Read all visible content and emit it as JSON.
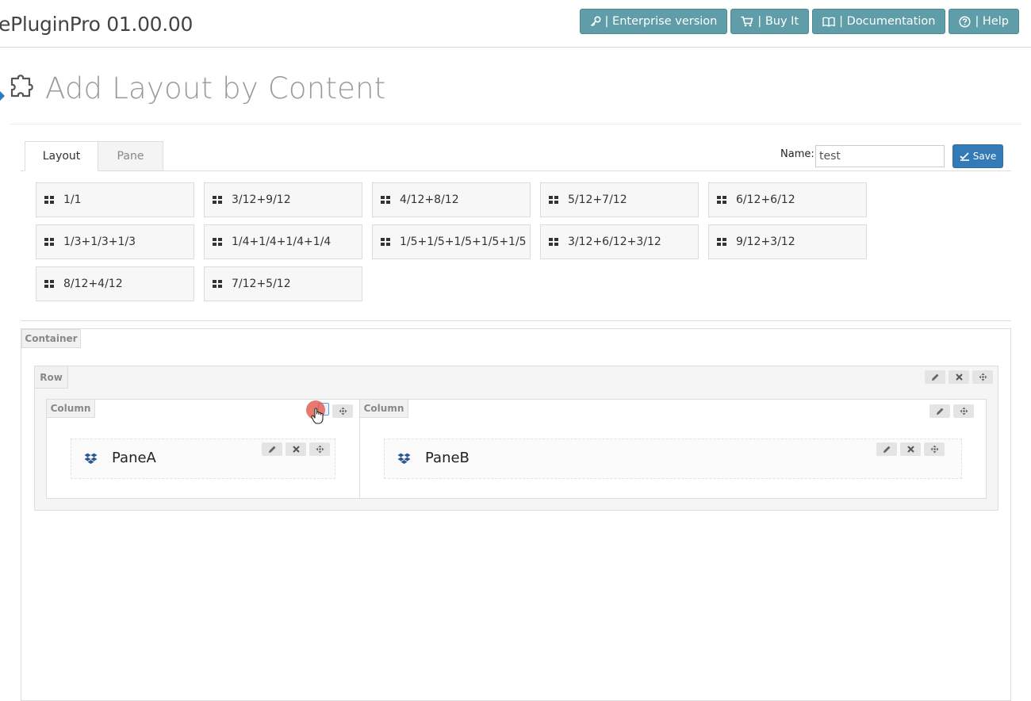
{
  "app": {
    "title": "ePluginPro 01.00.00"
  },
  "header": {
    "buttons": [
      {
        "label": "| Enterprise version",
        "icon": "key-icon"
      },
      {
        "label": "| Buy It",
        "icon": "cart-icon"
      },
      {
        "label": "| Documentation",
        "icon": "book-icon"
      },
      {
        "label": "| Help",
        "icon": "help-circle-icon"
      }
    ],
    "button_color": "#5f9ea8"
  },
  "page": {
    "title": "Add Layout by Content",
    "icon": "puzzle-icon"
  },
  "tabs": [
    {
      "label": "Layout",
      "active": true
    },
    {
      "label": "Pane",
      "active": false
    }
  ],
  "form": {
    "name_label": "Name:",
    "name_value": "test",
    "save_label": "Save",
    "save_color": "#337ab7"
  },
  "layouts": [
    "1/1",
    "3/12+9/12",
    "4/12+8/12",
    "5/12+7/12",
    "6/12+6/12",
    "1/3+1/3+1/3",
    "1/4+1/4+1/4+1/4",
    "1/5+1/5+1/5+1/5+1/5",
    "3/12+6/12+3/12",
    "9/12+3/12",
    "8/12+4/12",
    "7/12+5/12"
  ],
  "builder": {
    "container_label": "Container",
    "row_label": "Row",
    "columns": [
      {
        "label": "Column",
        "pane": "PaneA"
      },
      {
        "label": "Column",
        "pane": "PaneB"
      }
    ],
    "pane_icon": "dropbox-icon",
    "pane_icon_color": "#2a5a8f"
  }
}
